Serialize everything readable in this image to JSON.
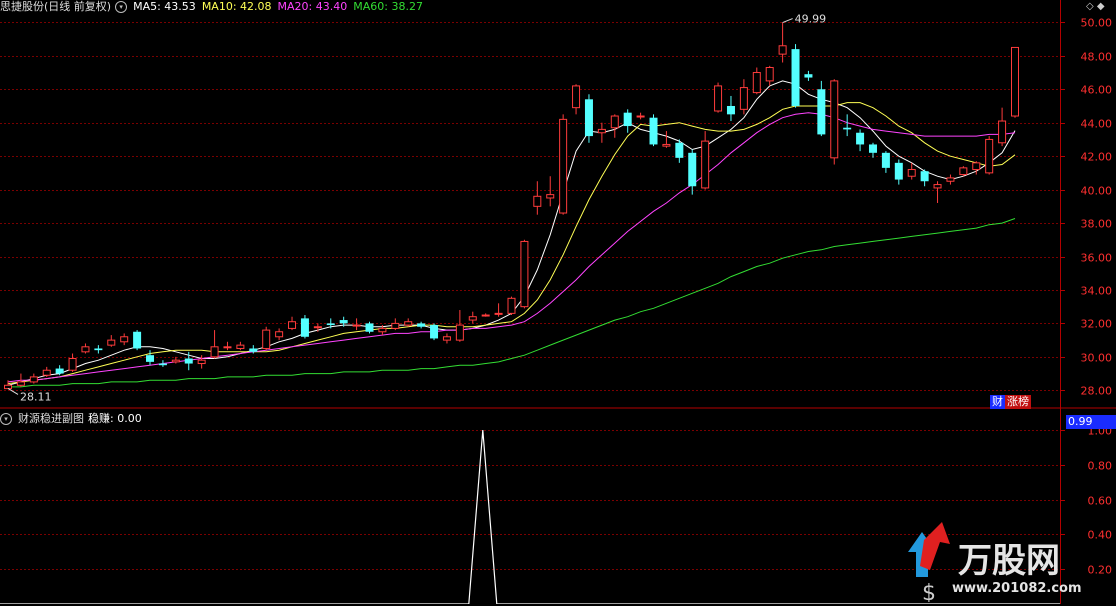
{
  "header": {
    "stock_title": "思捷股份(日线 前复权)",
    "ma5": "MA5: 43.53",
    "ma10": "MA10: 42.08",
    "ma20": "MA20: 43.40",
    "ma60": "MA60: 38.27"
  },
  "sub_header": {
    "title": "财源稳进副图",
    "value": "稳赚: 0.00"
  },
  "badges": {
    "cai": "财",
    "zhangbang": "涨榜",
    "sub_value": "0.99"
  },
  "annotations": {
    "high": "49.99",
    "low": "28.11"
  },
  "logo": {
    "name": "万股网",
    "url_text": "www.201082.com"
  },
  "colors": {
    "up": "#ff3c3c",
    "down": "#54ffff",
    "ma5": "#ffffff",
    "ma10": "#ffff55",
    "ma20": "#ff44ff",
    "ma60": "#33dd33",
    "grid": "#7a0000",
    "axis": "#b30000"
  },
  "chart_data": [
    {
      "type": "candlestick",
      "title": "思捷股份(日线 前复权)",
      "y_ticks": [
        "28.00",
        "30.00",
        "32.00",
        "34.00",
        "36.00",
        "38.00",
        "40.00",
        "42.00",
        "44.00",
        "46.00",
        "48.00",
        "50.00"
      ],
      "ylim": [
        27.3,
        50.5
      ],
      "candles": [
        [
          28.1,
          28.3,
          28.11,
          28.6
        ],
        [
          28.3,
          28.5,
          28.2,
          29.0
        ],
        [
          28.5,
          28.8,
          28.4,
          29.0
        ],
        [
          28.9,
          29.2,
          28.8,
          29.4
        ],
        [
          29.3,
          29.0,
          28.9,
          29.5
        ],
        [
          29.2,
          29.9,
          29.1,
          30.2
        ],
        [
          30.3,
          30.6,
          30.2,
          30.8
        ],
        [
          30.5,
          30.4,
          30.2,
          30.7
        ],
        [
          30.7,
          31.0,
          30.6,
          31.3
        ],
        [
          30.9,
          31.2,
          30.7,
          31.4
        ],
        [
          31.5,
          30.5,
          30.4,
          31.6
        ],
        [
          30.1,
          29.7,
          29.5,
          30.4
        ],
        [
          29.6,
          29.5,
          29.4,
          29.8
        ],
        [
          29.7,
          29.8,
          29.6,
          30.0
        ],
        [
          29.9,
          29.6,
          29.2,
          30.3
        ],
        [
          29.6,
          29.8,
          29.3,
          30.1
        ],
        [
          30.0,
          30.6,
          29.9,
          31.6
        ],
        [
          30.6,
          30.6,
          30.4,
          30.9
        ],
        [
          30.5,
          30.7,
          30.4,
          30.9
        ],
        [
          30.5,
          30.3,
          30.2,
          30.7
        ],
        [
          30.5,
          31.6,
          30.4,
          31.8
        ],
        [
          31.2,
          31.5,
          31.0,
          31.7
        ],
        [
          31.7,
          32.1,
          31.6,
          32.4
        ],
        [
          32.3,
          31.2,
          31.1,
          32.5
        ],
        [
          31.8,
          31.8,
          31.5,
          32.0
        ],
        [
          32.0,
          31.9,
          31.7,
          32.3
        ],
        [
          32.2,
          32.0,
          31.8,
          32.4
        ],
        [
          31.9,
          31.9,
          31.6,
          32.3
        ],
        [
          32.0,
          31.5,
          31.4,
          32.1
        ],
        [
          31.5,
          31.7,
          31.3,
          31.9
        ],
        [
          31.7,
          32.0,
          31.6,
          32.3
        ],
        [
          31.9,
          32.1,
          31.8,
          32.3
        ],
        [
          32.0,
          31.8,
          31.7,
          32.1
        ],
        [
          31.9,
          31.1,
          31.0,
          32.0
        ],
        [
          31.0,
          31.2,
          30.8,
          31.4
        ],
        [
          31.0,
          31.9,
          30.9,
          32.8
        ],
        [
          32.2,
          32.4,
          32.0,
          32.7
        ],
        [
          32.5,
          32.5,
          32.4,
          32.6
        ],
        [
          32.6,
          32.6,
          32.4,
          33.2
        ],
        [
          32.6,
          33.5,
          32.5,
          33.6
        ],
        [
          33.0,
          36.9,
          32.9,
          37.0
        ],
        [
          39.0,
          39.6,
          38.5,
          40.5
        ],
        [
          39.5,
          39.7,
          39.0,
          40.8
        ],
        [
          38.6,
          44.2,
          38.5,
          44.5
        ],
        [
          44.9,
          46.2,
          44.5,
          46.3
        ],
        [
          45.4,
          43.2,
          42.8,
          45.7
        ],
        [
          43.4,
          43.6,
          42.8,
          44.0
        ],
        [
          43.7,
          44.4,
          43.1,
          44.5
        ],
        [
          44.6,
          43.8,
          43.4,
          44.8
        ],
        [
          44.4,
          44.4,
          44.2,
          44.6
        ],
        [
          44.3,
          42.7,
          42.6,
          44.5
        ],
        [
          42.6,
          42.7,
          42.5,
          43.5
        ],
        [
          42.8,
          41.9,
          41.6,
          43.0
        ],
        [
          42.2,
          40.2,
          39.7,
          42.4
        ],
        [
          40.1,
          42.9,
          40.0,
          43.5
        ],
        [
          44.7,
          46.2,
          44.6,
          46.4
        ],
        [
          45.0,
          44.5,
          44.1,
          45.6
        ],
        [
          44.8,
          46.1,
          44.5,
          46.6
        ],
        [
          45.8,
          47.0,
          45.7,
          47.3
        ],
        [
          46.5,
          47.3,
          46.2,
          47.4
        ],
        [
          48.1,
          48.6,
          47.6,
          49.99
        ],
        [
          48.4,
          45.0,
          44.9,
          48.7
        ],
        [
          46.9,
          46.7,
          46.5,
          47.1
        ],
        [
          46.0,
          43.3,
          43.2,
          46.5
        ],
        [
          41.9,
          46.5,
          41.5,
          46.6
        ],
        [
          43.7,
          43.6,
          43.2,
          44.5
        ],
        [
          43.4,
          42.7,
          42.3,
          43.6
        ],
        [
          42.7,
          42.2,
          41.9,
          42.8
        ],
        [
          42.2,
          41.3,
          41.0,
          42.3
        ],
        [
          41.6,
          40.6,
          40.3,
          41.8
        ],
        [
          40.8,
          41.2,
          40.6,
          41.6
        ],
        [
          41.1,
          40.5,
          40.2,
          41.2
        ],
        [
          40.1,
          40.3,
          39.2,
          40.5
        ],
        [
          40.5,
          40.7,
          40.3,
          40.9
        ],
        [
          40.9,
          41.3,
          40.8,
          41.4
        ],
        [
          41.2,
          41.6,
          40.9,
          41.7
        ],
        [
          41.0,
          43.0,
          40.9,
          43.2
        ],
        [
          42.8,
          44.1,
          42.6,
          44.9
        ],
        [
          44.4,
          48.5,
          44.3,
          48.5
        ]
      ],
      "series": [
        {
          "name": "MA5",
          "color": "#ffffff",
          "values": [
            28.3,
            28.5,
            28.7,
            28.9,
            29.0,
            29.3,
            29.6,
            29.8,
            30.1,
            30.4,
            30.6,
            30.6,
            30.5,
            30.3,
            30.1,
            29.9,
            29.9,
            30.0,
            30.2,
            30.4,
            30.6,
            30.9,
            31.1,
            31.4,
            31.6,
            31.8,
            31.9,
            31.9,
            31.8,
            31.8,
            31.9,
            31.9,
            31.9,
            31.7,
            31.6,
            31.6,
            31.7,
            31.9,
            32.2,
            32.6,
            33.6,
            35.2,
            37.3,
            39.8,
            42.3,
            43.5,
            43.4,
            43.6,
            44.0,
            43.6,
            43.4,
            43.2,
            42.9,
            42.4,
            42.6,
            43.1,
            43.6,
            44.3,
            45.4,
            46.2,
            46.5,
            46.3,
            45.7,
            45.4,
            45.2,
            44.9,
            44.3,
            43.5,
            42.6,
            42.0,
            41.6,
            41.1,
            40.8,
            40.6,
            40.8,
            41.1,
            41.6,
            42.2,
            43.53
          ]
        },
        {
          "name": "MA10",
          "color": "#ffff55",
          "values": [
            28.4,
            28.5,
            28.6,
            28.7,
            28.8,
            29.0,
            29.2,
            29.4,
            29.6,
            29.8,
            30.0,
            30.2,
            30.3,
            30.4,
            30.4,
            30.4,
            30.3,
            30.3,
            30.3,
            30.3,
            30.3,
            30.4,
            30.6,
            30.8,
            31.0,
            31.2,
            31.4,
            31.5,
            31.6,
            31.7,
            31.7,
            31.8,
            31.9,
            31.9,
            31.8,
            31.8,
            31.8,
            31.9,
            32.0,
            32.1,
            32.6,
            33.4,
            34.6,
            36.1,
            37.8,
            39.4,
            40.8,
            42.1,
            43.2,
            43.9,
            43.8,
            43.9,
            44.0,
            43.8,
            43.6,
            43.5,
            43.5,
            43.6,
            43.9,
            44.3,
            44.8,
            45.0,
            45.0,
            45.0,
            45.0,
            45.2,
            45.2,
            44.9,
            44.4,
            43.8,
            43.4,
            42.8,
            42.3,
            42.0,
            41.8,
            41.6,
            41.4,
            41.5,
            42.08
          ]
        },
        {
          "name": "MA20",
          "color": "#ff44ff",
          "values": [
            28.5,
            28.6,
            28.6,
            28.7,
            28.8,
            28.9,
            29.0,
            29.1,
            29.2,
            29.3,
            29.4,
            29.5,
            29.6,
            29.7,
            29.8,
            29.9,
            30.0,
            30.1,
            30.2,
            30.3,
            30.4,
            30.5,
            30.6,
            30.7,
            30.8,
            30.9,
            31.0,
            31.1,
            31.2,
            31.3,
            31.4,
            31.4,
            31.5,
            31.5,
            31.6,
            31.6,
            31.7,
            31.7,
            31.8,
            31.9,
            32.1,
            32.6,
            33.2,
            33.9,
            34.6,
            35.4,
            36.1,
            36.8,
            37.5,
            38.1,
            38.7,
            39.2,
            39.8,
            40.3,
            40.9,
            41.5,
            42.2,
            42.8,
            43.4,
            43.9,
            44.3,
            44.5,
            44.6,
            44.5,
            44.3,
            44.0,
            43.8,
            43.6,
            43.5,
            43.4,
            43.3,
            43.2,
            43.2,
            43.2,
            43.2,
            43.2,
            43.3,
            43.3,
            43.4
          ]
        },
        {
          "name": "MA60",
          "color": "#33dd33",
          "values": [
            28.2,
            28.2,
            28.3,
            28.3,
            28.3,
            28.4,
            28.4,
            28.4,
            28.5,
            28.5,
            28.5,
            28.6,
            28.6,
            28.6,
            28.7,
            28.7,
            28.7,
            28.8,
            28.8,
            28.8,
            28.9,
            28.9,
            28.9,
            29.0,
            29.0,
            29.0,
            29.1,
            29.1,
            29.1,
            29.2,
            29.2,
            29.2,
            29.3,
            29.3,
            29.4,
            29.5,
            29.5,
            29.6,
            29.7,
            29.9,
            30.1,
            30.4,
            30.7,
            31.0,
            31.3,
            31.6,
            31.9,
            32.2,
            32.4,
            32.7,
            32.9,
            33.2,
            33.5,
            33.8,
            34.1,
            34.4,
            34.8,
            35.1,
            35.4,
            35.6,
            35.9,
            36.1,
            36.3,
            36.4,
            36.6,
            36.7,
            36.8,
            36.9,
            37.0,
            37.1,
            37.2,
            37.3,
            37.4,
            37.5,
            37.6,
            37.7,
            37.9,
            38.0,
            38.27
          ]
        }
      ]
    },
    {
      "type": "line",
      "title": "财源稳进副图",
      "y_ticks": [
        "1.00",
        "0.80",
        "0.60",
        "0.40",
        "0.20"
      ],
      "ylim": [
        0,
        1
      ],
      "series": [
        {
          "name": "稳赚",
          "color": "#ffffff",
          "values": [
            0,
            0,
            0,
            0,
            0,
            0,
            0,
            0,
            0,
            0,
            0,
            0,
            0,
            0,
            0,
            0,
            0,
            0,
            0,
            0,
            0,
            0,
            0,
            0,
            0,
            0,
            0,
            0,
            0,
            0,
            0,
            0,
            0,
            0,
            0,
            0,
            0,
            0,
            0,
            0,
            0,
            0,
            0,
            0,
            0,
            0,
            0,
            0,
            0,
            0,
            0,
            0,
            0,
            0,
            0,
            0,
            0,
            0,
            0,
            0,
            0,
            0,
            0,
            0,
            0,
            0,
            0,
            0,
            0,
            0,
            0,
            0,
            0,
            0,
            0,
            0,
            0,
            0,
            0
          ],
          "spike_index": 36,
          "spike_value": 1.0
        }
      ]
    }
  ]
}
